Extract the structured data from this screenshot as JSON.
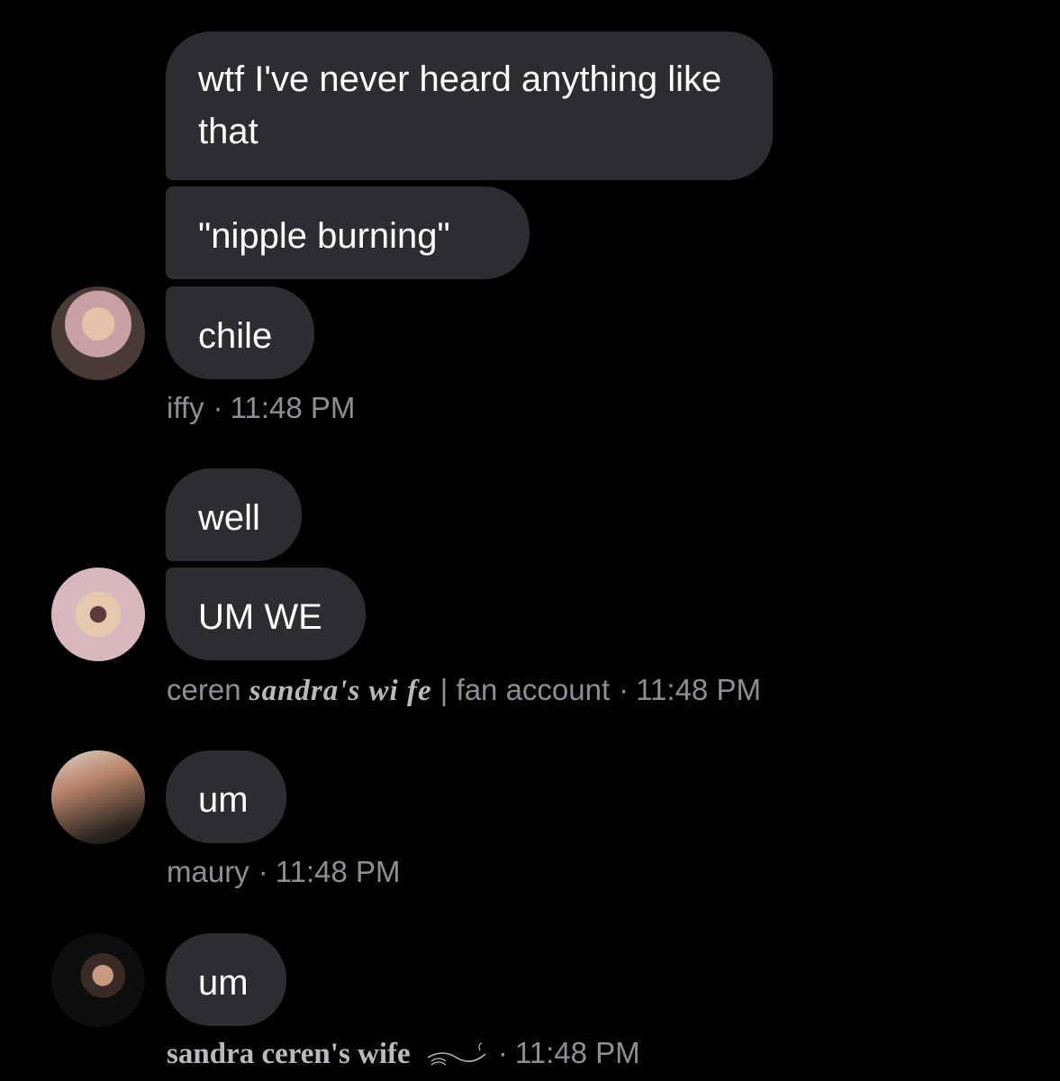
{
  "messages": [
    {
      "sender": "iffy",
      "time": "11:48 PM",
      "bubbles": [
        "wtf I've never heard anything like that",
        "\"nipple burning\"",
        "chile"
      ]
    },
    {
      "sender_plain": "ceren",
      "sender_fancy": "sandra's wi fe",
      "sender_suffix": "| fan account",
      "time": "11:48 PM",
      "bubbles": [
        "well",
        "UM WE"
      ]
    },
    {
      "sender": "maury",
      "time": "11:48 PM",
      "bubbles": [
        "um"
      ]
    },
    {
      "sender": "sandra ceren's wife",
      "time": "11:48 PM",
      "bubbles": [
        "um"
      ]
    }
  ],
  "separator": "·",
  "colors": {
    "background": "#000000",
    "bubble": "#2c2d30",
    "bubble_text": "#ffffff",
    "meta_text": "#8e8f94"
  }
}
